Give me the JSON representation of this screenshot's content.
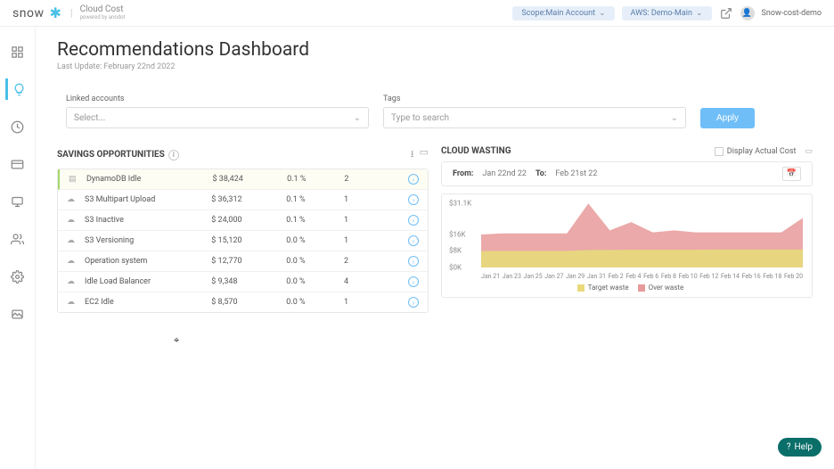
{
  "header": {
    "logo_main": "snow",
    "logo_sub": "Cloud Cost",
    "logo_sub2": "powered by anodot",
    "scope_label": "Scope:Main Account",
    "aws_scope": "AWS: Demo-Main",
    "user_name": "Snow-cost-demo"
  },
  "page": {
    "title": "Recommendations Dashboard",
    "subtitle": "Last Update: February 22nd 2022"
  },
  "filters": {
    "linked_label": "Linked accounts",
    "linked_placeholder": "Select...",
    "tags_label": "Tags",
    "tags_placeholder": "Type to search",
    "apply": "Apply"
  },
  "savings": {
    "title": "SAVINGS OPPORTUNITIES",
    "rows": [
      {
        "name": "DynamoDB Idle",
        "amount": "$ 38,424",
        "pct": "0.1 %",
        "count": "2",
        "hi": true
      },
      {
        "name": "S3 Multipart Upload",
        "amount": "$ 36,312",
        "pct": "0.1 %",
        "count": "1",
        "hi": false
      },
      {
        "name": "S3 Inactive",
        "amount": "$ 24,000",
        "pct": "0.1 %",
        "count": "1",
        "hi": false
      },
      {
        "name": "S3 Versioning",
        "amount": "$ 15,120",
        "pct": "0.0 %",
        "count": "1",
        "hi": false
      },
      {
        "name": "Operation system",
        "amount": "$ 12,770",
        "pct": "0.0 %",
        "count": "2",
        "hi": false
      },
      {
        "name": "Idle Load Balancer",
        "amount": "$ 9,348",
        "pct": "0.0 %",
        "count": "4",
        "hi": false
      },
      {
        "name": "EC2 Idle",
        "amount": "$ 8,570",
        "pct": "0.0 %",
        "count": "1",
        "hi": false
      }
    ]
  },
  "wasting": {
    "title": "CLOUD WASTING",
    "actual_cost_label": "Display Actual Cost",
    "from_label": "From:",
    "from_value": "Jan 22nd 22",
    "to_label": "To:",
    "to_value": "Feb 21st 22",
    "legend_target": "Target waste",
    "legend_over": "Over waste"
  },
  "chart_data": {
    "type": "area",
    "xlabels": [
      "Jan 21",
      "Jan 23",
      "Jan 25",
      "Jan 27",
      "Jan 29",
      "Jan 31",
      "Feb 2",
      "Feb 4",
      "Feb 6",
      "Feb 8",
      "Feb 10",
      "Feb 12",
      "Feb 14",
      "Feb 16",
      "Feb 18",
      "Feb 20"
    ],
    "ylabels": [
      "$31.1K",
      "$16K",
      "$8K",
      "$0K"
    ],
    "yvalues": [
      31100,
      16000,
      8000,
      0
    ],
    "ylim": [
      0,
      31100
    ],
    "series": [
      {
        "name": "Target waste",
        "color": "#e8d97a",
        "values": [
          8000,
          8000,
          8000,
          8000,
          8000,
          8500,
          8500,
          8600,
          8600,
          8600,
          8600,
          8700,
          8700,
          8700,
          8700,
          8700
        ]
      },
      {
        "name": "Over waste",
        "color": "#e89a9a",
        "values": [
          16000,
          16500,
          16500,
          16500,
          16500,
          31000,
          18000,
          22000,
          17000,
          18000,
          17000,
          17000,
          17000,
          17000,
          17000,
          24000
        ]
      }
    ]
  },
  "help": "Help"
}
